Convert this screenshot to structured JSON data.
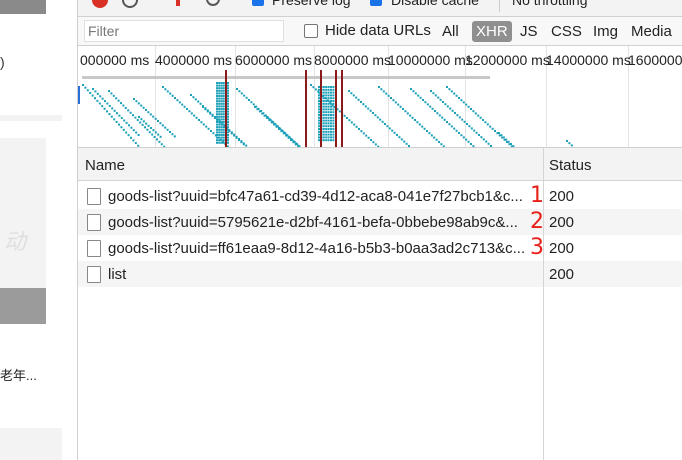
{
  "left_page": {
    "paren": ")",
    "card_text": "动",
    "snippet": "老年..."
  },
  "top_toolbar": {
    "preserve_log_label": "Preserve log",
    "disable_cache_label": "Disable cache",
    "throttling_label": "No throttling"
  },
  "filter_bar": {
    "filter_placeholder": "Filter",
    "hide_data_urls_label": "Hide data URLs",
    "hide_data_urls_checked": false,
    "types": [
      "All",
      "XHR",
      "JS",
      "CSS",
      "Img",
      "Media"
    ],
    "active_type": "XHR"
  },
  "overview": {
    "ticks": [
      "000000 ms",
      "4000000 ms",
      "6000000 ms",
      "8000000 ms",
      "10000000 ms",
      "12000000 ms",
      "14000000 ms",
      "1600000"
    ],
    "colors": {
      "bars": "#1ba0b8",
      "markers": "#8b1a1a"
    }
  },
  "table": {
    "headers": {
      "name": "Name",
      "status": "Status"
    },
    "rows": [
      {
        "name": "goods-list?uuid=bfc47a61-cd39-4d12-aca8-041e7f27bcb1&c...",
        "status": "200",
        "annotation": "1"
      },
      {
        "name": "goods-list?uuid=5795621e-d2bf-4161-befa-0bbebe98ab9c&...",
        "status": "200",
        "annotation": "2"
      },
      {
        "name": "goods-list?uuid=ff61eaa9-8d12-4a16-b5b3-b0aa3ad2c713&c...",
        "status": "200",
        "annotation": "3"
      },
      {
        "name": "list",
        "status": "200",
        "annotation": ""
      }
    ]
  }
}
